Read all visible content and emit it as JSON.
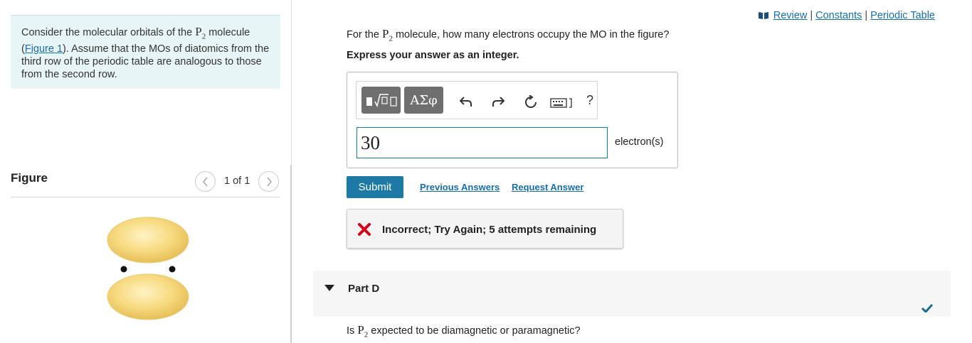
{
  "intro": {
    "text_before": "Consider the molecular orbitals of the ",
    "formula_main": "P",
    "formula_sub": "2",
    "text_after": " molecule",
    "link_open_paren": "(",
    "figure_link": "Figure 1",
    "text_rest": "). Assume that the MOs of diatomics from the third row of the periodic table are analogous to those from the second row."
  },
  "figure_panel": {
    "title": "Figure",
    "prev_icon": "chevron-left-icon",
    "next_icon": "chevron-right-icon",
    "pager_text": "1 of 1"
  },
  "top_links": {
    "book_icon": "book-icon",
    "review": "Review",
    "sep1": "|",
    "constants": "Constants",
    "sep2": "|",
    "periodic_table": "Periodic Table"
  },
  "question": {
    "before": "For the ",
    "formula_main": "P",
    "formula_sub": "2",
    "after": " molecule, how many electrons occupy the MO in the figure?",
    "instruction": "Express your answer as an integer."
  },
  "toolbar": {
    "templates_icon": "templates-icon",
    "symbols_label": "ΑΣφ",
    "undo_icon": "undo-icon",
    "redo_icon": "redo-icon",
    "reset_icon": "reset-icon",
    "keyboard_icon": "keyboard-icon",
    "help_label": "?"
  },
  "answer": {
    "value": "30",
    "unit": "electron(s)"
  },
  "actions": {
    "submit": "Submit",
    "previous_answers": "Previous Answers",
    "request_answer": "Request Answer"
  },
  "feedback": {
    "icon": "x-icon",
    "text": "Incorrect; Try Again; 5 attempts remaining"
  },
  "part_d": {
    "caret_icon": "caret-down-icon",
    "title": "Part D",
    "check_icon": "checkmark-icon",
    "question_before": "Is ",
    "formula_main": "P",
    "formula_sub": "2",
    "question_after": " expected to be diamagnetic or paramagnetic?"
  },
  "colors": {
    "accent": "#1c7aa5",
    "intro_bg": "#e7f5f6",
    "error": "#d0001a",
    "lobe": "#f5d77e",
    "check": "#1a6e8a"
  }
}
